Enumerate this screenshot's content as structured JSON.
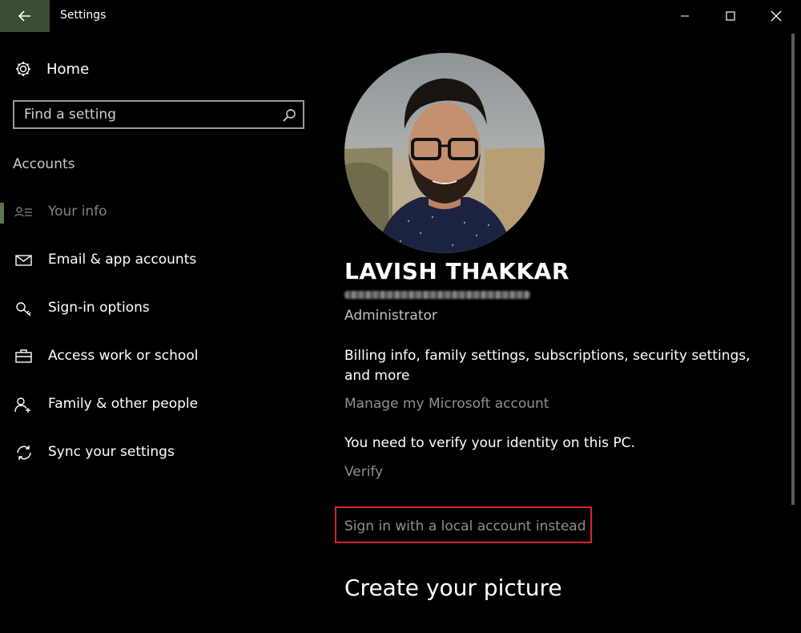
{
  "window": {
    "title": "Settings"
  },
  "sidebar": {
    "home_label": "Home",
    "search_placeholder": "Find a setting",
    "section_title": "Accounts",
    "items": [
      {
        "label": "Your info",
        "icon": "user-card-icon",
        "active": true
      },
      {
        "label": "Email & app accounts",
        "icon": "mail-icon"
      },
      {
        "label": "Sign-in options",
        "icon": "key-icon"
      },
      {
        "label": "Access work or school",
        "icon": "briefcase-icon"
      },
      {
        "label": "Family & other people",
        "icon": "add-person-icon"
      },
      {
        "label": "Sync your settings",
        "icon": "sync-icon"
      }
    ]
  },
  "profile": {
    "name": "LAVISH THAKKAR",
    "role": "Administrator",
    "billing_text": "Billing info, family settings, subscriptions, security settings, and more",
    "manage_link": "Manage my Microsoft account",
    "verify_text": "You need to verify your identity on this PC.",
    "verify_link": "Verify",
    "local_account_link": "Sign in with a local account instead",
    "create_picture_heading": "Create your picture"
  },
  "colors": {
    "accent": "#5d7553",
    "highlight": "#d0282e",
    "link": "#8f8f8f"
  }
}
